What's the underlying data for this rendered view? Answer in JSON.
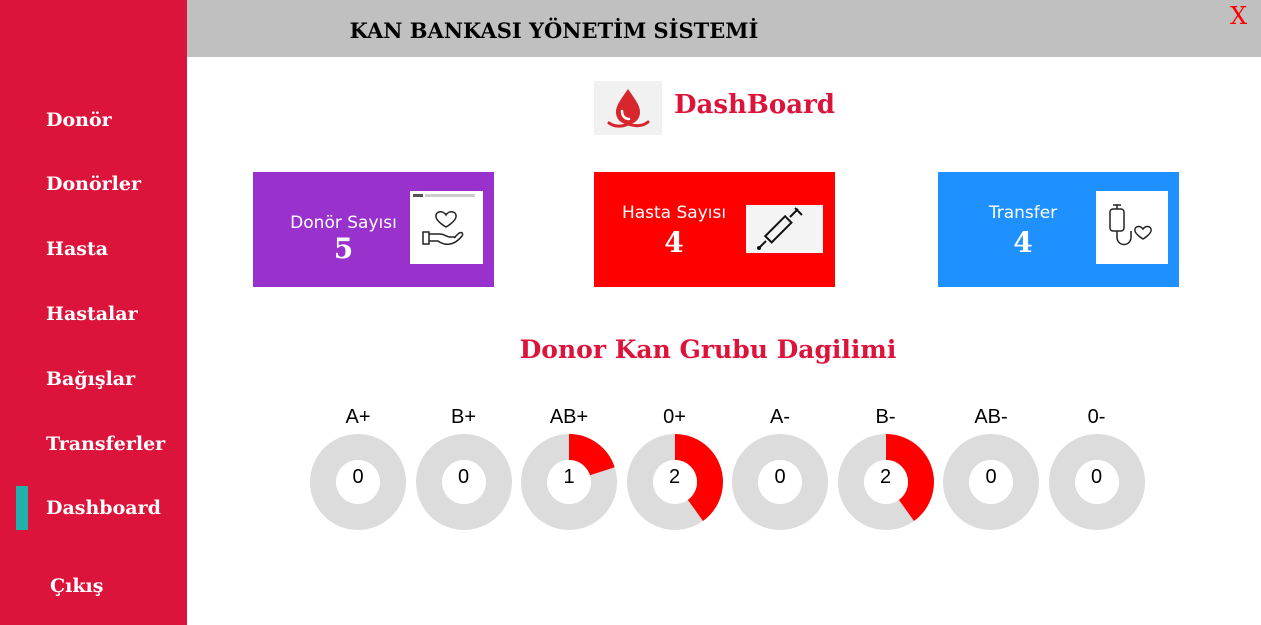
{
  "app": {
    "title": "KAN BANKASI YÖNETİM SİSTEMİ",
    "close_label": "X"
  },
  "sidebar": {
    "items": [
      {
        "label": "Donör"
      },
      {
        "label": "Donörler"
      },
      {
        "label": "Hasta"
      },
      {
        "label": "Hastalar"
      },
      {
        "label": "Bağışlar"
      },
      {
        "label": "Transferler"
      },
      {
        "label": "Dashboard",
        "active": true
      },
      {
        "label": "Çıkış"
      }
    ]
  },
  "dashboard": {
    "title": "DashBoard",
    "logo_icon": "blood-drop-hand-icon"
  },
  "cards": [
    {
      "label": "Donör Sayısı",
      "value": "5",
      "color": "#9932cc",
      "icon": "heart-in-hand-icon"
    },
    {
      "label": "Hasta Sayısı",
      "value": "4",
      "color": "#ff0000",
      "icon": "syringe-icon"
    },
    {
      "label": "Transfer",
      "value": "4",
      "color": "#1e90ff",
      "icon": "iv-bag-heart-icon"
    }
  ],
  "distribution": {
    "title": "Donor Kan Grubu Dagilimi",
    "groups": [
      {
        "label": "A+",
        "count": "0",
        "fraction": 0
      },
      {
        "label": "B+",
        "count": "0",
        "fraction": 0
      },
      {
        "label": "AB+",
        "count": "1",
        "fraction": 0.2
      },
      {
        "label": "0+",
        "count": "2",
        "fraction": 0.4
      },
      {
        "label": "A-",
        "count": "0",
        "fraction": 0
      },
      {
        "label": "B-",
        "count": "2",
        "fraction": 0.4
      },
      {
        "label": "AB-",
        "count": "0",
        "fraction": 0
      },
      {
        "label": "0-",
        "count": "0",
        "fraction": 0
      }
    ],
    "fill_color": "#ff0000",
    "track_color": "#dcdcdc"
  }
}
